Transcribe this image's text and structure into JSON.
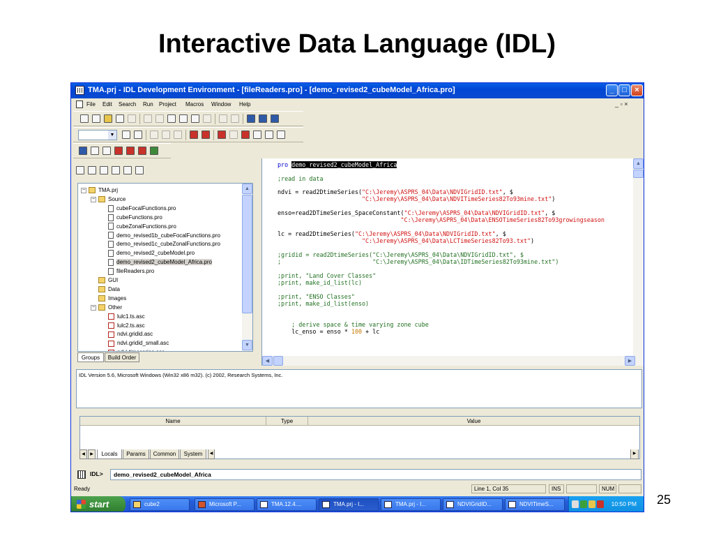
{
  "slide": {
    "title": "Interactive Data Language (IDL)",
    "page_number": "25"
  },
  "window": {
    "title": "TMA.prj - IDL Development Environment - [fileReaders.pro] - [demo_revised2_cubeModel_Africa.pro]",
    "minimize": "_",
    "maximize": "□",
    "close": "×"
  },
  "menu": {
    "items": [
      "File",
      "Edit",
      "Search",
      "Run",
      "Project",
      "Macros",
      "Window",
      "Help"
    ],
    "mdi_controls": "_ ▫ ×"
  },
  "tree": {
    "items": [
      {
        "label": "TMA.prj",
        "type": "folder",
        "expander": "−",
        "depth": 0
      },
      {
        "label": "Source",
        "type": "folder",
        "expander": "−",
        "depth": 1
      },
      {
        "label": "cubeFocalFunctions.pro",
        "type": "file",
        "depth": 2
      },
      {
        "label": "cubeFunctions.pro",
        "type": "file",
        "depth": 2
      },
      {
        "label": "cubeZonalFunctions.pro",
        "type": "file",
        "depth": 2
      },
      {
        "label": "demo_revised1b_cubeFocalFunctions.pro",
        "type": "file",
        "depth": 2
      },
      {
        "label": "demo_revised1c_cubeZonalFunctions.pro",
        "type": "file",
        "depth": 2
      },
      {
        "label": "demo_revised2_cubeModel.pro",
        "type": "file",
        "depth": 2
      },
      {
        "label": "demo_revised2_cubeModel_Africa.pro",
        "type": "file",
        "depth": 2,
        "selected": true
      },
      {
        "label": "fileReaders.pro",
        "type": "file",
        "depth": 2
      },
      {
        "label": "GUI",
        "type": "folder",
        "depth": 1
      },
      {
        "label": "Data",
        "type": "folder",
        "depth": 1
      },
      {
        "label": "Images",
        "type": "folder",
        "depth": 1
      },
      {
        "label": "Other",
        "type": "folder",
        "expander": "−",
        "depth": 1
      },
      {
        "label": "lulc1.ts.asc",
        "type": "data",
        "depth": 2
      },
      {
        "label": "lulc2.ts.asc",
        "type": "data",
        "depth": 2
      },
      {
        "label": "ndvi.gridid.asc",
        "type": "data",
        "depth": 2
      },
      {
        "label": "ndvi.gridid_small.asc",
        "type": "data",
        "depth": 2
      },
      {
        "label": "ndvi.timeseries.asc",
        "type": "data",
        "depth": 2
      }
    ],
    "tabs": [
      "Groups",
      "Build Order"
    ]
  },
  "editor": {
    "lines": [
      {
        "parts": [
          {
            "t": "pro ",
            "c": "kw"
          },
          {
            "t": "demo_revised2_cubeModel_Africa",
            "c": "hl"
          }
        ]
      },
      {
        "parts": [
          {
            "t": ";read in data",
            "c": "cmt"
          }
        ]
      },
      {
        "parts": [
          {
            "t": "ndvi = read2DtimeSeries(",
            "c": ""
          },
          {
            "t": "\"C:\\Jeremy\\ASPRS_04\\Data\\NDVIGridID.txt\"",
            "c": "str"
          },
          {
            "t": ", $",
            "c": ""
          }
        ]
      },
      {
        "parts": [
          {
            "t": "                        ",
            "c": ""
          },
          {
            "t": "\"C:\\Jeremy\\ASPRS_04\\Data\\NDVITimeSeries82To93mine.txt\"",
            "c": "str"
          },
          {
            "t": ")",
            "c": ""
          }
        ]
      },
      {
        "parts": [
          {
            "t": "enso=read2DTimeSeries_SpaceConstant(",
            "c": ""
          },
          {
            "t": "\"C:\\Jeremy\\ASPRS_04\\Data\\NDVIGridID.txt\"",
            "c": "str"
          },
          {
            "t": ", $",
            "c": ""
          }
        ]
      },
      {
        "parts": [
          {
            "t": "                                   ",
            "c": ""
          },
          {
            "t": "\"C:\\Jeremy\\ASPRS_04\\Data\\ENSOTimeSeries82To93growingseason",
            "c": "str"
          }
        ]
      },
      {
        "parts": [
          {
            "t": "lc = read2DtimeSeries(",
            "c": ""
          },
          {
            "t": "\"C:\\Jeremy\\ASPRS_04\\Data\\NDVIGridID.txt\"",
            "c": "str"
          },
          {
            "t": ", $",
            "c": ""
          }
        ]
      },
      {
        "parts": [
          {
            "t": "                        ",
            "c": ""
          },
          {
            "t": "\"C:\\Jeremy\\ASPRS_04\\Data\\LCTimeSeries82To93.txt\"",
            "c": "str"
          },
          {
            "t": ")",
            "c": ""
          }
        ]
      },
      {
        "parts": [
          {
            "t": ";gridid = read2DtimeSeries(\"C:\\Jeremy\\ASPRS_04\\Data\\NDVIGridID.txt\", $",
            "c": "cmt"
          }
        ]
      },
      {
        "parts": [
          {
            "t": ";                          \"C:\\Jeremy\\ASPRS_04\\Data\\IDTimeSeries82To93mine.txt\")",
            "c": "cmt"
          }
        ]
      },
      {
        "parts": [
          {
            "t": ";print, \"Land Cover Classes\"",
            "c": "cmt"
          }
        ]
      },
      {
        "parts": [
          {
            "t": ";print, make_id_list(lc)",
            "c": "cmt"
          }
        ]
      },
      {
        "parts": [
          {
            "t": ";print, \"ENSO Classes\"",
            "c": "cmt"
          }
        ]
      },
      {
        "parts": [
          {
            "t": ";print, make_id_list(enso)",
            "c": "cmt"
          }
        ]
      },
      {
        "parts": [
          {
            "t": "    ; derive space & time varying zone cube",
            "c": "cmt"
          }
        ]
      },
      {
        "parts": [
          {
            "t": "    lc_enso = enso ",
            "c": ""
          },
          {
            "t": "*",
            "c": ""
          },
          {
            "t": " 100",
            "c": "num"
          },
          {
            "t": " + lc",
            "c": ""
          }
        ]
      }
    ]
  },
  "output_log": {
    "text": "IDL Version 5.6, Microsoft Windows (Win32 x86 m32). (c) 2002, Research Systems, Inc."
  },
  "variables": {
    "columns": [
      "Name",
      "Type",
      "Value"
    ],
    "tabs": [
      "Locals",
      "Params",
      "Common",
      "System"
    ]
  },
  "command_line": {
    "prompt": "IDL>",
    "value": "demo_revised2_cubeModel_Africa"
  },
  "status": {
    "ready": "Ready",
    "position": "Line 1, Col 35",
    "ins": "INS",
    "num": "NUM"
  },
  "taskbar": {
    "start_label": "start",
    "buttons": [
      {
        "label": "cube2",
        "icon": "folder"
      },
      {
        "label": "Microsoft P...",
        "icon": "ppt"
      },
      {
        "label": "TMA.12.4....",
        "icon": "window"
      },
      {
        "label": "TMA.prj - I...",
        "icon": "window",
        "active": true
      },
      {
        "label": "TMA.prj - I...",
        "icon": "window"
      },
      {
        "label": "NDVIGridID...",
        "icon": "doc"
      },
      {
        "label": "NDVITimeS...",
        "icon": "doc"
      }
    ],
    "clock": "10:50 PM"
  },
  "colors": {
    "keyword": "#0000cc",
    "string": "#d01010",
    "comment": "#1f6f1f",
    "number": "#c57a00",
    "titlebar": "#0a5fe6",
    "taskbar": "#245edb",
    "start_green": "#3c8f3b"
  }
}
